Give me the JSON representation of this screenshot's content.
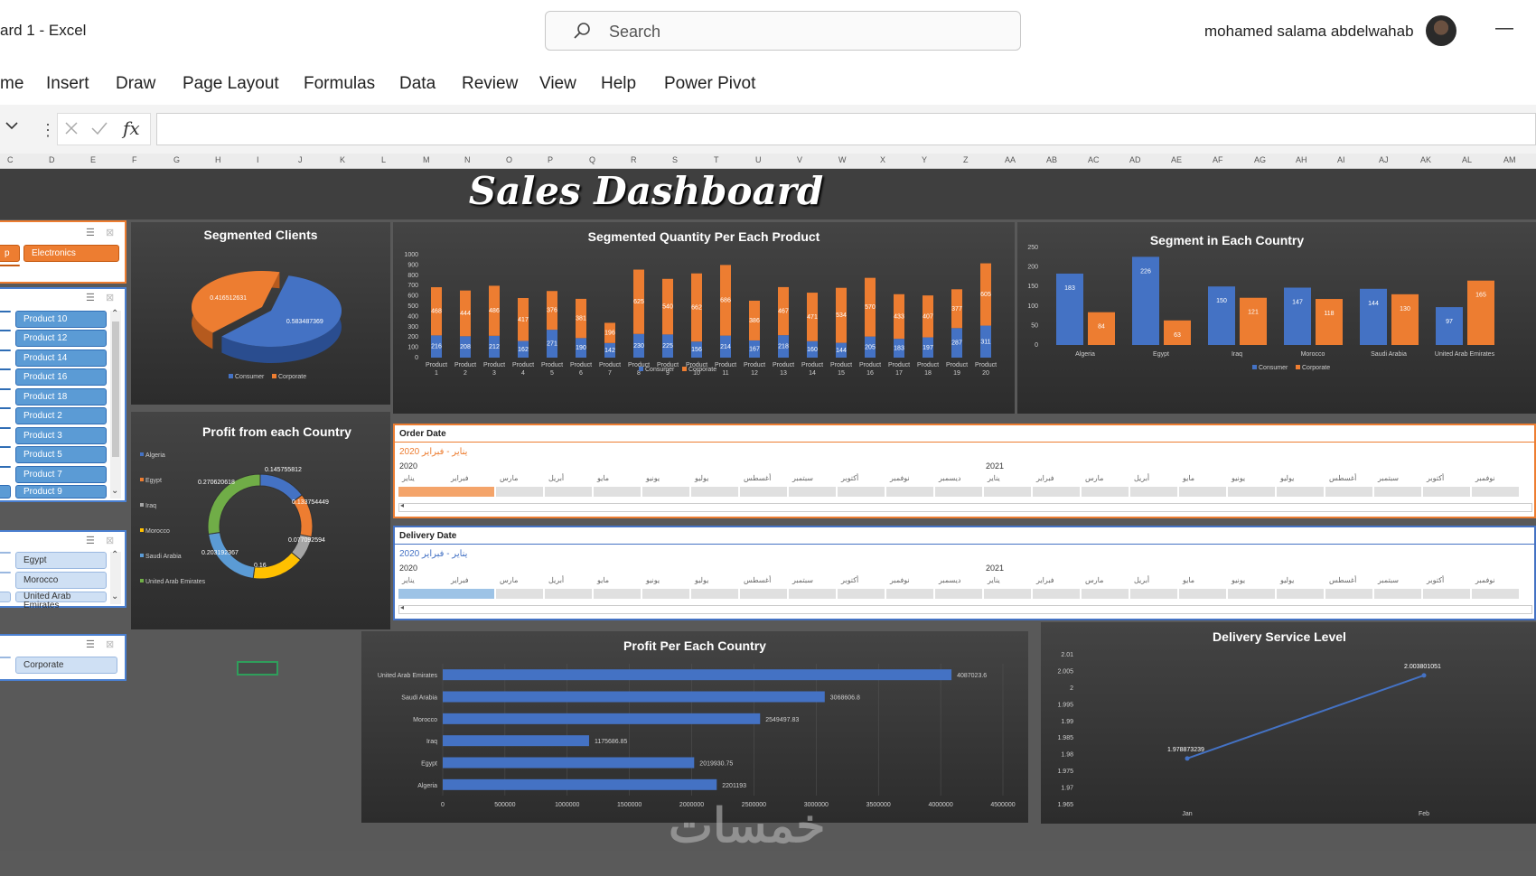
{
  "window": {
    "title": "ard 1  -  Excel",
    "search_placeholder": "Search",
    "user_name": "mohamed salama abdelwahab",
    "minimize_glyph": "—"
  },
  "ribbon": {
    "tabs": [
      "me",
      "Insert",
      "Draw",
      "Page Layout",
      "Formulas",
      "Data",
      "Review",
      "View",
      "Help",
      "Power Pivot"
    ]
  },
  "formula_bar": {
    "fx_label": "fx",
    "value": ""
  },
  "columns": [
    "C",
    "D",
    "E",
    "F",
    "G",
    "H",
    "I",
    "J",
    "K",
    "L",
    "M",
    "N",
    "O",
    "P",
    "Q",
    "R",
    "S",
    "T",
    "U",
    "V",
    "W",
    "X",
    "Y",
    "Z",
    "AA",
    "AB",
    "AC",
    "AD",
    "AE",
    "AF",
    "AG",
    "AH",
    "AI",
    "AJ",
    "AK",
    "AL",
    "AM"
  ],
  "dashboard": {
    "title": "Sales Dashboard"
  },
  "slicers": {
    "category": {
      "items": [
        "p",
        "Electronics"
      ]
    },
    "product": {
      "items": [
        "Product 10",
        "Product 12",
        "Product 14",
        "Product 16",
        "Product 18",
        "Product 2",
        "Product 3",
        "Product 5",
        "Product 7",
        "Product 9"
      ]
    },
    "country": {
      "items": [
        "Egypt",
        "Morocco",
        "United Arab Emirates"
      ]
    },
    "segment": {
      "items": [
        "Corporate"
      ]
    }
  },
  "timelines": [
    {
      "header": "Order Date",
      "range_text": "يناير - فبراير 2020",
      "year1": "2020",
      "year2": "2021",
      "months": [
        "يناير",
        "فبراير",
        "مارس",
        "أبريل",
        "مايو",
        "يونيو",
        "يوليو",
        "أغسطس",
        "سبتمبر",
        "أكتوبر",
        "نوفمبر",
        "ديسمبر",
        "يناير",
        "فبراير",
        "مارس",
        "أبريل",
        "مايو",
        "يونيو",
        "يوليو",
        "أغسطس",
        "سبتمبر",
        "أكتوبر",
        "نوفمبر"
      ],
      "highlight_color": "#f4a46a",
      "accent": "#ed7d31"
    },
    {
      "header": "Delivery Date",
      "range_text": "يناير - فبراير 2020",
      "year1": "2020",
      "year2": "2021",
      "months": [
        "يناير",
        "فبراير",
        "مارس",
        "أبريل",
        "مايو",
        "يونيو",
        "يوليو",
        "أغسطس",
        "سبتمبر",
        "أكتوبر",
        "نوفمبر",
        "ديسمبر",
        "يناير",
        "فبراير",
        "مارس",
        "أبريل",
        "مايو",
        "يونيو",
        "يوليو",
        "أغسطس",
        "سبتمبر",
        "أكتوبر",
        "نوفمبر"
      ],
      "highlight_color": "#9dc3e6",
      "accent": "#4472c4"
    }
  ],
  "colors": {
    "consumer": "#4472c4",
    "corporate": "#ed7d31",
    "panel_dark": "#2c2c2c"
  },
  "watermark": "خمسات",
  "chart_data": [
    {
      "id": "segmented-clients",
      "type": "pie",
      "title": "Segmented Clients",
      "categories": [
        "Consumer",
        "Corporate"
      ],
      "values": [
        0.583487369,
        0.416512631
      ],
      "labels": [
        "0.583487369",
        "0.416512631"
      ],
      "legend": [
        "Consumer",
        "Corporate"
      ],
      "legend_position": "bottom"
    },
    {
      "id": "segmented-quantity",
      "type": "bar",
      "stacked": true,
      "title": "Segmented Quantity Per Each Product",
      "categories": [
        "Product 1",
        "Product 2",
        "Product 3",
        "Product 4",
        "Product 5",
        "Product 6",
        "Product 7",
        "Product 8",
        "Product 9",
        "Product 10",
        "Product 11",
        "Product 12",
        "Product 13",
        "Product 14",
        "Product 15",
        "Product 16",
        "Product 17",
        "Product 18",
        "Product 19",
        "Product 20"
      ],
      "series": [
        {
          "name": "Consumer",
          "values": [
            216,
            208,
            212,
            162,
            271,
            190,
            142,
            230,
            225,
            156,
            214,
            167,
            218,
            160,
            144,
            205,
            183,
            197,
            287,
            311
          ]
        },
        {
          "name": "Corporate",
          "values": [
            468,
            444,
            486,
            417,
            376,
            381,
            196,
            625,
            540,
            662,
            686,
            386,
            467,
            471,
            534,
            570,
            433,
            407,
            377,
            605
          ]
        }
      ],
      "ylim": [
        0,
        1000
      ],
      "yticks": [
        0,
        100,
        200,
        300,
        400,
        500,
        600,
        700,
        800,
        900,
        1000
      ],
      "legend_position": "bottom"
    },
    {
      "id": "segment-country",
      "type": "bar",
      "title": "Segment in Each Country",
      "categories": [
        "Algeria",
        "Egypt",
        "Iraq",
        "Morocco",
        "Saudi Arabia",
        "United Arab Emirates"
      ],
      "series": [
        {
          "name": "Consumer",
          "values": [
            183,
            226,
            150,
            147,
            144,
            97
          ]
        },
        {
          "name": "Corporate",
          "values": [
            84,
            63,
            121,
            118,
            130,
            165
          ]
        }
      ],
      "ylim": [
        0,
        250
      ],
      "yticks": [
        0,
        50,
        100,
        150,
        200,
        250
      ],
      "legend_position": "bottom"
    },
    {
      "id": "profit-country-donut",
      "type": "pie",
      "donut": true,
      "title": "Profit from each Country",
      "categories": [
        "Algeria",
        "Egypt",
        "Iraq",
        "Morocco",
        "Saudi Arabia",
        "United Arab Emirates"
      ],
      "values": [
        0.145755812,
        0.133754449,
        0.077092594,
        0.16,
        0.203192367,
        0.270620618
      ],
      "labels": [
        "0.145755812",
        "0.133754449",
        "0.077092594",
        "0.16",
        "0.203192367",
        "0.270620618"
      ],
      "colors": [
        "#4472c4",
        "#ed7d31",
        "#a5a5a5",
        "#ffc000",
        "#5b9bd5",
        "#70ad47"
      ],
      "legend_position": "left"
    },
    {
      "id": "profit-per-country",
      "type": "bar",
      "orientation": "horizontal",
      "title": "Profit Per Each Country",
      "categories": [
        "United Arab Emirates",
        "Saudi Arabia",
        "Morocco",
        "Iraq",
        "Egypt",
        "Algeria"
      ],
      "values": [
        4087023.6,
        3068606.8,
        2549497.83,
        1175686.85,
        2019930.75,
        2201193
      ],
      "labels": [
        "4087023.6",
        "3068606.8",
        "2549497.83",
        "1175686.85",
        "2019930.75",
        "2201193"
      ],
      "xlim": [
        0,
        4500000
      ],
      "xticks": [
        0,
        500000,
        1000000,
        1500000,
        2000000,
        2500000,
        3000000,
        3500000,
        4000000,
        4500000
      ]
    },
    {
      "id": "delivery-service",
      "type": "line",
      "title": "Delivery Service Level",
      "categories": [
        "Jan",
        "Feb"
      ],
      "values": [
        1.978873239,
        2.003801051
      ],
      "labels": [
        "1.978873239",
        "2.003801051"
      ],
      "ylim": [
        1.965,
        2.01
      ],
      "yticks": [
        "1.965",
        "1.97",
        "1.975",
        "1.98",
        "1.985",
        "1.99",
        "1.995",
        "2",
        "2.005",
        "2.01"
      ]
    }
  ]
}
